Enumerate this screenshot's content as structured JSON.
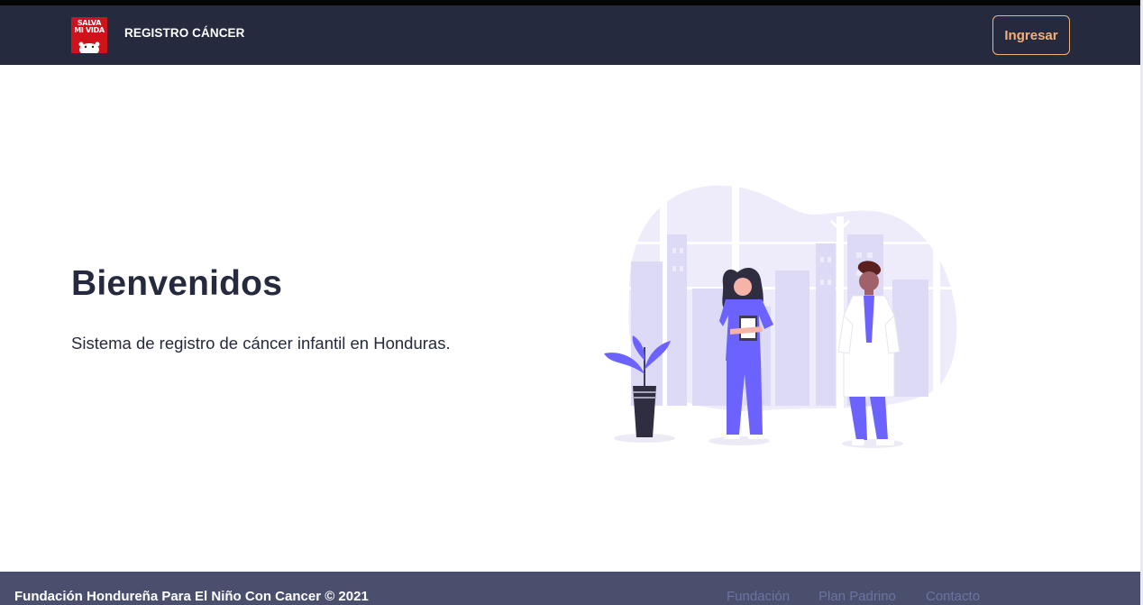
{
  "header": {
    "logo_text_line1": "SALVA",
    "logo_text_line2": "MI VIDA",
    "brand": "REGISTRO CÁNCER",
    "login_label": "Ingresar"
  },
  "hero": {
    "title": "Bienvenidos",
    "subtitle": "Sistema de registro de cáncer infantil en Honduras.",
    "illustration": "medical-staff-illustration"
  },
  "footer": {
    "copyright": "Fundación Hondureña Para El Niño Con Cancer © 2021",
    "links": [
      "Fundación",
      "Plan Padrino",
      "Contacto"
    ]
  },
  "colors": {
    "navbar": "#262a3e",
    "footer": "#4a4f6e",
    "accent": "#f2b27a",
    "illustration_primary": "#6c63ff",
    "logo_red": "#d0121a"
  }
}
